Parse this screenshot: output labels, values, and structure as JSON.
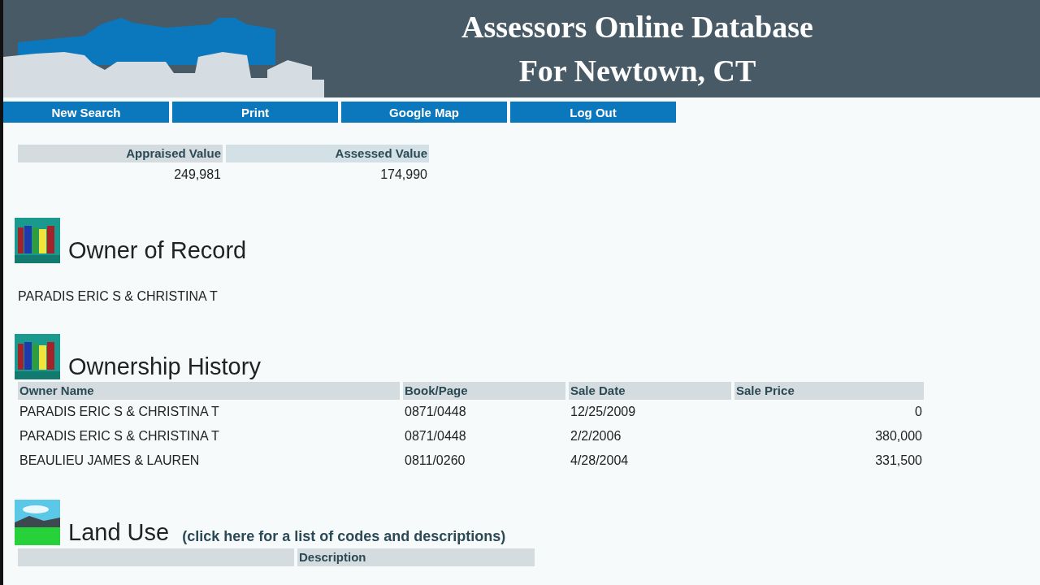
{
  "header": {
    "title_lines": [
      "Assessors Online Database",
      "For Newtown, CT"
    ]
  },
  "nav": [
    {
      "label": "New Search"
    },
    {
      "label": "Print"
    },
    {
      "label": "Google Map"
    },
    {
      "label": "Log Out"
    }
  ],
  "values": {
    "columns": [
      "Appraised Value",
      "Assessed Value"
    ],
    "row": [
      "249,981",
      "174,990"
    ]
  },
  "owner_of_record": {
    "title": "Owner of Record",
    "owner": "PARADIS ERIC S & CHRISTINA T"
  },
  "ownership_history": {
    "title": "Ownership History",
    "columns": [
      "Owner Name",
      "Book/Page",
      "Sale Date",
      "Sale Price"
    ],
    "rows": [
      [
        "PARADIS ERIC S & CHRISTINA T",
        "0871/0448",
        "12/25/2009",
        "0"
      ],
      [
        "PARADIS ERIC S & CHRISTINA T",
        "0871/0448",
        "2/2/2006",
        "380,000"
      ],
      [
        "BEAULIEU JAMES & LAUREN",
        "0811/0260",
        "4/28/2004",
        "331,500"
      ]
    ]
  },
  "land_use": {
    "title": "Land Use",
    "link": "(click here for a list of codes and descriptions)",
    "columns": [
      "Description"
    ]
  }
}
